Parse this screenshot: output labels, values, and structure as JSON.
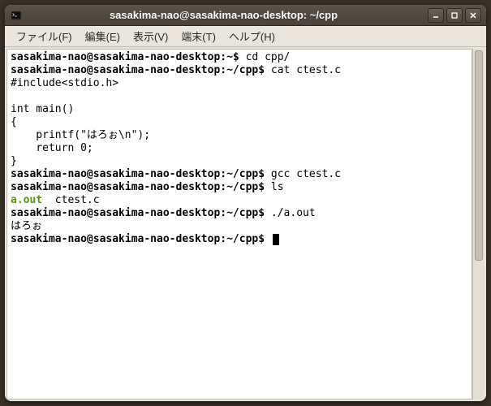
{
  "window": {
    "title": "sasakima-nao@sasakima-nao-desktop: ~/cpp"
  },
  "menu": {
    "file": "ファイル(F)",
    "edit": "編集(E)",
    "view": "表示(V)",
    "terminal": "端末(T)",
    "help": "ヘルプ(H)"
  },
  "term": {
    "prompt_home": "sasakima-nao@sasakima-nao-desktop:~$",
    "prompt_cpp": "sasakima-nao@sasakima-nao-desktop:~/cpp$",
    "cmd_cd": " cd cpp/",
    "cmd_cat": " cat ctest.c",
    "src_l1": "#include<stdio.h>",
    "src_l2": "",
    "src_l3": "int main()",
    "src_l4": "{",
    "src_l5": "    printf(\"はろぉ\\n\");",
    "src_l6": "    return 0;",
    "src_l7": "}",
    "cmd_gcc": " gcc ctest.c",
    "cmd_ls": " ls",
    "ls_exec": "a.out",
    "ls_file": "  ctest.c",
    "cmd_run": " ./a.out",
    "out_run": "はろぉ",
    "cmd_empty": " "
  }
}
